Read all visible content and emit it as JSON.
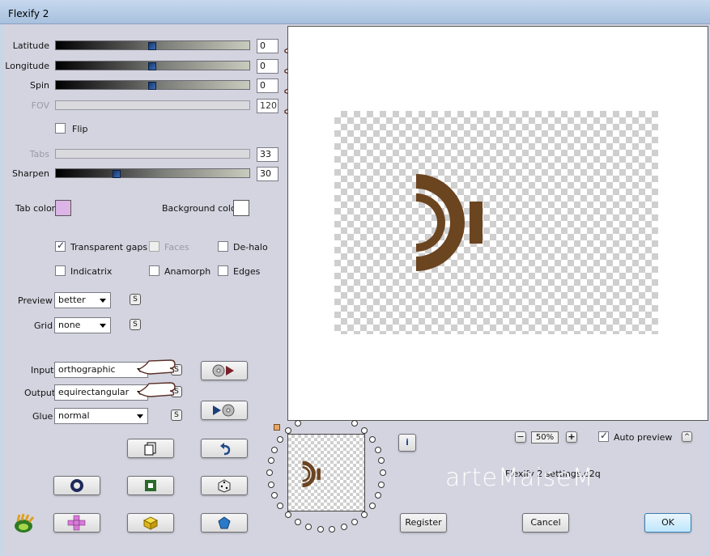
{
  "window": {
    "title": "Flexify 2"
  },
  "sliders": {
    "latitude": {
      "label": "Latitude",
      "value": "0"
    },
    "longitude": {
      "label": "Longitude",
      "value": "0"
    },
    "spin": {
      "label": "Spin",
      "value": "0"
    },
    "fov": {
      "label": "FOV",
      "value": "120"
    },
    "tabs": {
      "label": "Tabs",
      "value": "33"
    },
    "sharpen": {
      "label": "Sharpen",
      "value": "30"
    }
  },
  "flip": {
    "label": "Flip",
    "checked": false
  },
  "colors": {
    "tab_color": {
      "label": "Tab color",
      "value": "#dcb4e6"
    },
    "background_color": {
      "label": "Background color",
      "value": "#ffffff"
    },
    "shape": "#6b4420"
  },
  "options": {
    "transparent_gaps": {
      "label": "Transparent gaps",
      "checked": true
    },
    "faces": {
      "label": "Faces",
      "checked": false
    },
    "de_halo": {
      "label": "De-halo",
      "checked": false
    },
    "indicatrix": {
      "label": "Indicatrix",
      "checked": false
    },
    "anamorph": {
      "label": "Anamorph",
      "checked": false
    },
    "edges": {
      "label": "Edges",
      "checked": false
    }
  },
  "preview": {
    "label": "Preview",
    "selected": "better"
  },
  "grid": {
    "label": "Grid",
    "selected": "none"
  },
  "input": {
    "label": "Input",
    "selected": "orthographic"
  },
  "output": {
    "label": "Output",
    "selected": "equirectangular"
  },
  "glue": {
    "label": "Glue",
    "selected": "normal"
  },
  "s_button_label": "S",
  "zoom": {
    "value": "50%",
    "minus": "−",
    "plus": "+"
  },
  "auto_preview": {
    "label": "Auto preview",
    "checked": true
  },
  "settings_file": "Flexify 2 settings.o2q",
  "watermark": "arteMaiseM",
  "buttons": {
    "register": "Register",
    "cancel": "Cancel",
    "ok": "OK",
    "info": "i",
    "collapse": "^"
  },
  "icons": [
    "copy-icon",
    "undo-icon",
    "ring-icon",
    "square-frame-icon",
    "dice-icon",
    "app-logo-icon",
    "cross-icon",
    "cube-icon",
    "pentagon-icon",
    "play-in-icon",
    "play-out-icon"
  ]
}
